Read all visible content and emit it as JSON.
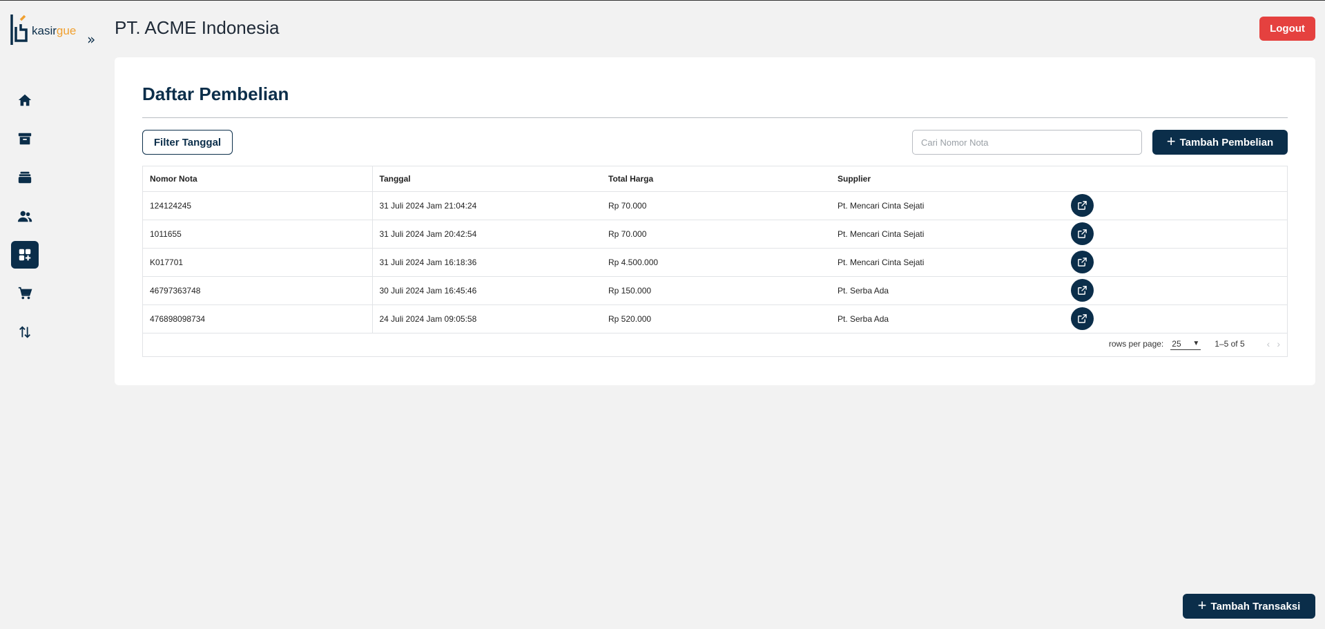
{
  "brand": {
    "logo_text_a": "kasir",
    "logo_text_b": "gue"
  },
  "header": {
    "company": "PT. ACME Indonesia",
    "logout_label": "Logout"
  },
  "page": {
    "title": "Daftar Pembelian",
    "filter_label": "Filter Tanggal",
    "search_placeholder": "Cari Nomor Nota",
    "search_value": "",
    "add_label": "Tambah Pembelian"
  },
  "table": {
    "columns": [
      "Nomor Nota",
      "Tanggal",
      "Total Harga",
      "Supplier"
    ],
    "rows": [
      {
        "nota": "124124245",
        "tanggal": "31 Juli 2024 Jam 21:04:24",
        "total": "Rp 70.000",
        "supplier": "Pt. Mencari Cinta Sejati"
      },
      {
        "nota": "1011655",
        "tanggal": "31 Juli 2024 Jam 20:42:54",
        "total": "Rp 70.000",
        "supplier": "Pt. Mencari Cinta Sejati"
      },
      {
        "nota": "K017701",
        "tanggal": "31 Juli 2024 Jam 16:18:36",
        "total": "Rp 4.500.000",
        "supplier": "Pt. Mencari Cinta Sejati"
      },
      {
        "nota": "46797363748",
        "tanggal": "30 Juli 2024 Jam 16:45:46",
        "total": "Rp 150.000",
        "supplier": "Pt. Serba Ada"
      },
      {
        "nota": "476898098734",
        "tanggal": "24 Juli 2024 Jam 09:05:58",
        "total": "Rp 520.000",
        "supplier": "Pt. Serba Ada"
      }
    ],
    "footer": {
      "rows_per_page_label": "rows per page:",
      "rows_per_page": "25",
      "range": "1–5 of 5"
    }
  },
  "bottom": {
    "transaksi_label": "Tambah Transaksi"
  },
  "colors": {
    "primary": "#0b2e4a",
    "danger": "#e5413f",
    "accent": "#f0a030"
  },
  "icons": [
    "home-icon",
    "archive-icon",
    "stack-icon",
    "users-icon",
    "apps-add-icon",
    "cart-icon",
    "sort-arrows-icon",
    "external-link-icon"
  ]
}
